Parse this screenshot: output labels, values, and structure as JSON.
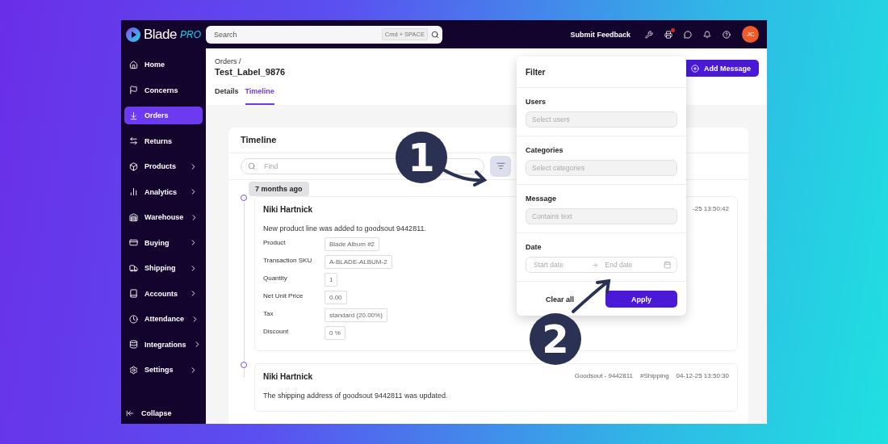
{
  "topbar": {
    "logo": {
      "name": "Blade",
      "suffix": "PRO"
    },
    "search": {
      "placeholder": "Search",
      "shortcut": "Cmd + SPACE"
    },
    "feedback": "Submit Feedback",
    "printer_alert": true,
    "avatar": "JC"
  },
  "sidebar": {
    "items": [
      {
        "label": "Home",
        "expandable": false,
        "selected": false
      },
      {
        "label": "Concerns",
        "expandable": false,
        "selected": false
      },
      {
        "label": "Orders",
        "expandable": false,
        "selected": true
      },
      {
        "label": "Returns",
        "expandable": false,
        "selected": false
      },
      {
        "label": "Products",
        "expandable": true,
        "selected": false
      },
      {
        "label": "Analytics",
        "expandable": true,
        "selected": false
      },
      {
        "label": "Warehouse",
        "expandable": true,
        "selected": false
      },
      {
        "label": "Buying",
        "expandable": true,
        "selected": false
      },
      {
        "label": "Shipping",
        "expandable": true,
        "selected": false
      },
      {
        "label": "Accounts",
        "expandable": true,
        "selected": false
      },
      {
        "label": "Attendance",
        "expandable": true,
        "selected": false
      },
      {
        "label": "Integrations",
        "expandable": true,
        "selected": false
      },
      {
        "label": "Settings",
        "expandable": true,
        "selected": false
      }
    ],
    "collapse": "Collapse"
  },
  "page": {
    "breadcrumb": "Orders /",
    "title": "Test_Label_9876",
    "tabs": [
      {
        "label": "Details",
        "selected": false
      },
      {
        "label": "Timeline",
        "selected": true
      }
    ],
    "add_button": "Add Message"
  },
  "timeline": {
    "title": "Timeline",
    "find_placeholder": "Find",
    "group_label": "7 months ago",
    "entries": [
      {
        "author": "Niki Hartnick",
        "meta": [
          "-25 13:50:42"
        ],
        "message": "New product line was added to goodsout 9442811.",
        "fields": [
          {
            "label": "Product",
            "value": "Blade Album #2"
          },
          {
            "label": "Transaction SKU",
            "value": "A-BLADE-ALBUM-2"
          },
          {
            "label": "Quantity",
            "value": "1"
          },
          {
            "label": "Net Unit Price",
            "value": "0.00"
          },
          {
            "label": "Tax",
            "value": "standard (20.00%)"
          },
          {
            "label": "Discount",
            "value": "0 %"
          }
        ]
      },
      {
        "author": "Niki Hartnick",
        "meta": [
          "Goodsout - 9442811",
          "#Shipping",
          "04-12-25 13:50:30"
        ],
        "message": "The shipping address of goodsout 9442811 was updated."
      }
    ]
  },
  "filter": {
    "title": "Filter",
    "sections": [
      {
        "label": "Users",
        "kind": "select",
        "placeholder": "Select users"
      },
      {
        "label": "Categories",
        "kind": "select",
        "placeholder": "Select categories"
      },
      {
        "label": "Message",
        "kind": "text",
        "placeholder": "Contains text"
      },
      {
        "label": "Date",
        "kind": "daterange",
        "start_placeholder": "Start date",
        "end_placeholder": "End date"
      }
    ],
    "clear": "Clear all",
    "apply": "Apply"
  },
  "annotations": [
    {
      "label": "1",
      "kind": "down-right"
    },
    {
      "label": "2",
      "kind": "up-right"
    }
  ]
}
